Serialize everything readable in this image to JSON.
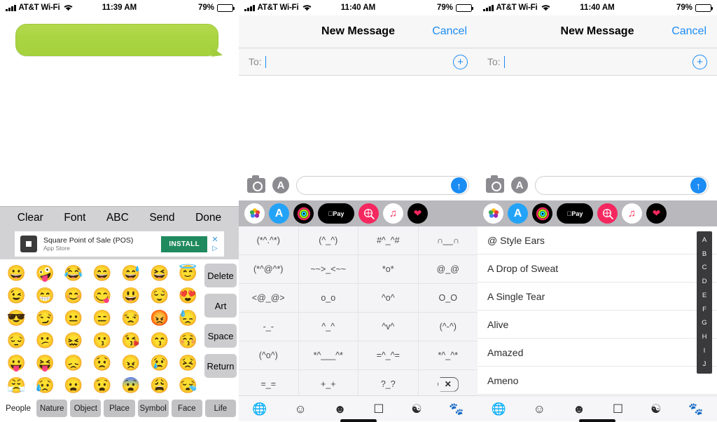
{
  "panels": {
    "left": {
      "statusbar": {
        "carrier": "AT&T Wi-Fi",
        "time": "11:39 AM",
        "battery": "79%"
      },
      "toolbar": [
        "Clear",
        "Font",
        "ABC",
        "Send",
        "Done"
      ],
      "ad": {
        "title": "Square Point of Sale (POS)",
        "subtitle": "App Store",
        "cta": "INSTALL",
        "close": "✕",
        "play": "▷"
      },
      "emoji_rows": [
        [
          "😀",
          "🤪",
          "😂",
          "😄",
          "😅",
          "😆",
          "😇"
        ],
        [
          "😉",
          "😁",
          "😊",
          "😋",
          "😃",
          "😌",
          "😍"
        ],
        [
          "😎",
          "😏",
          "😐",
          "😑",
          "😒",
          "😡",
          "😓"
        ],
        [
          "😔",
          "😕",
          "😖",
          "😗",
          "😘",
          "😙",
          "😚"
        ],
        [
          "😛",
          "😝",
          "😞",
          "😟",
          "😠",
          "😢",
          "😣"
        ],
        [
          "😤",
          "😥",
          "😦",
          "😧",
          "😨",
          "😩",
          "😪"
        ]
      ],
      "side_keys": [
        "Delete",
        "Art",
        "Space",
        "Return"
      ],
      "categories": [
        {
          "label": "People",
          "active": true
        },
        {
          "label": "Nature",
          "active": false
        },
        {
          "label": "Object",
          "active": false
        },
        {
          "label": "Place",
          "active": false
        },
        {
          "label": "Symbol",
          "active": false
        },
        {
          "label": "Face",
          "active": false
        },
        {
          "label": "Life",
          "active": false
        }
      ]
    },
    "middle": {
      "statusbar": {
        "carrier": "AT&T Wi-Fi",
        "time": "11:40 AM",
        "battery": "79%"
      },
      "nav": {
        "title": "New Message",
        "cancel": "Cancel"
      },
      "to_row": {
        "label": "To:"
      },
      "compose": {
        "placeholder": ""
      },
      "app_drawer": [
        "photos-icon",
        "app-store-icon",
        "fitness-rings-icon",
        "apple-pay-icon",
        "images-search-icon",
        "music-icon",
        "digital-touch-icon"
      ],
      "kaomoji": [
        "(*^.^*)",
        "(^_^)",
        "#^_^#",
        "∩__∩",
        "(*^@^*)",
        "~~>_<~~",
        "*o*",
        "@_@",
        "<@_@>",
        "o_o",
        "^o^",
        "O_O",
        "-_-",
        "^_^",
        "^v^",
        "(^-^)",
        "(^o^)",
        "*^___^*",
        "=^_^=",
        "*^_^*",
        "=_=",
        "+_+",
        "?_?"
      ],
      "keyboard_icons": [
        "globe-icon",
        "smiley-icon",
        "star-eyes-icon",
        "square-face-icon",
        "yin-yang-icon",
        "paw-print-icon"
      ]
    },
    "right": {
      "statusbar": {
        "carrier": "AT&T Wi-Fi",
        "time": "11:40 AM",
        "battery": "79%"
      },
      "nav": {
        "title": "New Message",
        "cancel": "Cancel"
      },
      "to_row": {
        "label": "To:"
      },
      "compose": {
        "placeholder": ""
      },
      "app_drawer": [
        "photos-icon",
        "app-store-icon",
        "fitness-rings-icon",
        "apple-pay-icon",
        "images-search-icon",
        "music-icon",
        "digital-touch-icon"
      ],
      "art_list": [
        "@ Style Ears",
        "A Drop of Sweat",
        "A Single Tear",
        "Alive",
        "Amazed",
        "Ameno"
      ],
      "index_letters": [
        "A",
        "B",
        "C",
        "D",
        "E",
        "F",
        "G",
        "H",
        "I",
        "J"
      ],
      "keyboard_icons": [
        "globe-icon",
        "smiley-icon",
        "star-eyes-icon",
        "square-face-icon",
        "yin-yang-icon",
        "paw-print-icon"
      ]
    }
  },
  "colors": {
    "bubble_green": "#aad442",
    "ios_blue": "#1b8cf3",
    "install_green": "#1f8a5e",
    "keyboard_gray": "#d2d2d4",
    "drawer_gray": "#b8b8bd",
    "index_dark": "#3a3a3c"
  }
}
